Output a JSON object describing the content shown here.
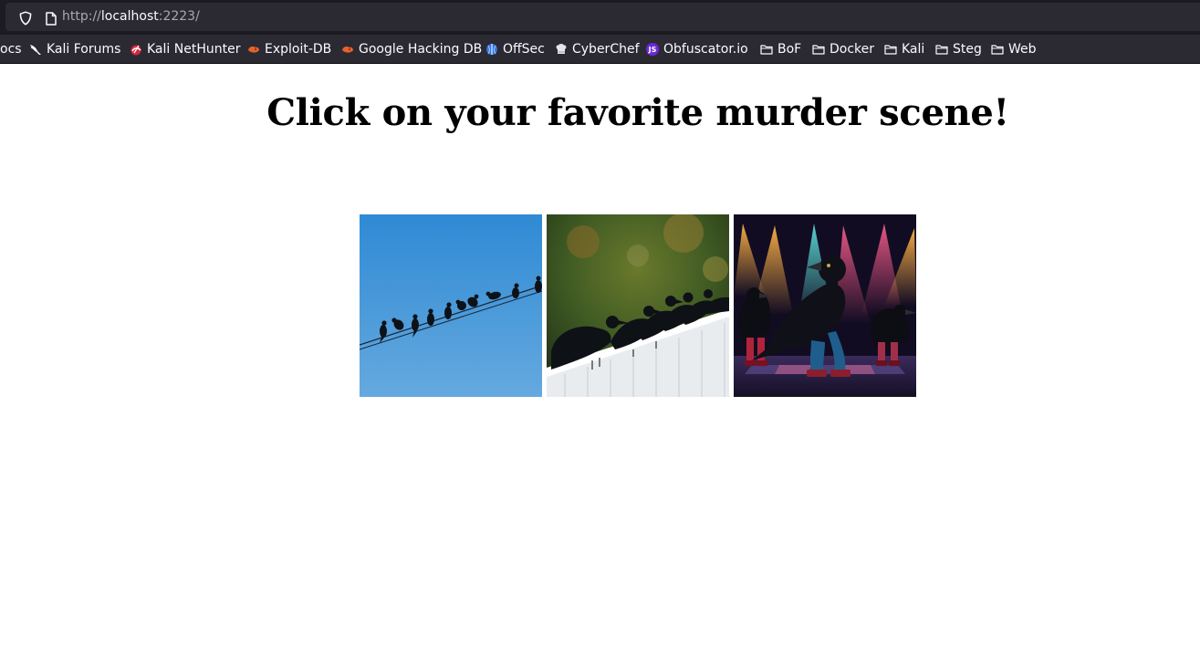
{
  "browser": {
    "url": {
      "scheme": "http://",
      "host": "localhost",
      "rest": ":2223/"
    },
    "bookmarks": [
      {
        "label": "ocs",
        "icon": "none"
      },
      {
        "label": "Kali Forums",
        "icon": "kali-dragon-icon"
      },
      {
        "label": "Kali NetHunter",
        "icon": "nethunter-icon"
      },
      {
        "label": "Exploit-DB",
        "icon": "exploit-db-icon"
      },
      {
        "label": "Google Hacking DB",
        "icon": "ghdb-icon"
      },
      {
        "label": "OffSec",
        "icon": "offsec-icon"
      },
      {
        "label": "CyberChef",
        "icon": "cyberchef-icon"
      },
      {
        "label": "Obfuscator.io",
        "icon": "obfuscator-icon"
      },
      {
        "label": "BoF",
        "icon": "folder-icon"
      },
      {
        "label": "Docker",
        "icon": "folder-icon"
      },
      {
        "label": "Kali",
        "icon": "folder-icon"
      },
      {
        "label": "Steg",
        "icon": "folder-icon"
      },
      {
        "label": "Web",
        "icon": "folder-icon"
      }
    ]
  },
  "page": {
    "heading": "Click on your favorite murder scene!",
    "scenes": [
      {
        "name": "crows-on-wire",
        "description_icon": "crows-on-power-line-image"
      },
      {
        "name": "crows-on-fence",
        "description_icon": "crows-on-white-fence-image"
      },
      {
        "name": "disco-crows",
        "description_icon": "dancing-crows-stage-image"
      }
    ]
  },
  "colors": {
    "toolbar_bg": "#1c1b22",
    "urlbar_bg": "#2b2a33",
    "text_light": "#fbfbfe",
    "text_dim": "#a8a8ae"
  }
}
